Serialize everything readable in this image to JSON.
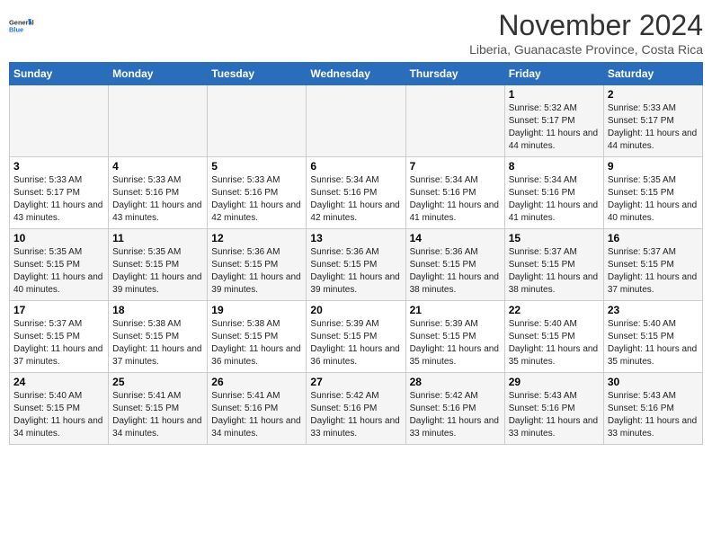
{
  "header": {
    "logo_line1": "General",
    "logo_line2": "Blue",
    "month": "November 2024",
    "location": "Liberia, Guanacaste Province, Costa Rica"
  },
  "weekdays": [
    "Sunday",
    "Monday",
    "Tuesday",
    "Wednesday",
    "Thursday",
    "Friday",
    "Saturday"
  ],
  "weeks": [
    [
      {
        "day": "",
        "info": ""
      },
      {
        "day": "",
        "info": ""
      },
      {
        "day": "",
        "info": ""
      },
      {
        "day": "",
        "info": ""
      },
      {
        "day": "",
        "info": ""
      },
      {
        "day": "1",
        "info": "Sunrise: 5:32 AM\nSunset: 5:17 PM\nDaylight: 11 hours and 44 minutes."
      },
      {
        "day": "2",
        "info": "Sunrise: 5:33 AM\nSunset: 5:17 PM\nDaylight: 11 hours and 44 minutes."
      }
    ],
    [
      {
        "day": "3",
        "info": "Sunrise: 5:33 AM\nSunset: 5:17 PM\nDaylight: 11 hours and 43 minutes."
      },
      {
        "day": "4",
        "info": "Sunrise: 5:33 AM\nSunset: 5:16 PM\nDaylight: 11 hours and 43 minutes."
      },
      {
        "day": "5",
        "info": "Sunrise: 5:33 AM\nSunset: 5:16 PM\nDaylight: 11 hours and 42 minutes."
      },
      {
        "day": "6",
        "info": "Sunrise: 5:34 AM\nSunset: 5:16 PM\nDaylight: 11 hours and 42 minutes."
      },
      {
        "day": "7",
        "info": "Sunrise: 5:34 AM\nSunset: 5:16 PM\nDaylight: 11 hours and 41 minutes."
      },
      {
        "day": "8",
        "info": "Sunrise: 5:34 AM\nSunset: 5:16 PM\nDaylight: 11 hours and 41 minutes."
      },
      {
        "day": "9",
        "info": "Sunrise: 5:35 AM\nSunset: 5:15 PM\nDaylight: 11 hours and 40 minutes."
      }
    ],
    [
      {
        "day": "10",
        "info": "Sunrise: 5:35 AM\nSunset: 5:15 PM\nDaylight: 11 hours and 40 minutes."
      },
      {
        "day": "11",
        "info": "Sunrise: 5:35 AM\nSunset: 5:15 PM\nDaylight: 11 hours and 39 minutes."
      },
      {
        "day": "12",
        "info": "Sunrise: 5:36 AM\nSunset: 5:15 PM\nDaylight: 11 hours and 39 minutes."
      },
      {
        "day": "13",
        "info": "Sunrise: 5:36 AM\nSunset: 5:15 PM\nDaylight: 11 hours and 39 minutes."
      },
      {
        "day": "14",
        "info": "Sunrise: 5:36 AM\nSunset: 5:15 PM\nDaylight: 11 hours and 38 minutes."
      },
      {
        "day": "15",
        "info": "Sunrise: 5:37 AM\nSunset: 5:15 PM\nDaylight: 11 hours and 38 minutes."
      },
      {
        "day": "16",
        "info": "Sunrise: 5:37 AM\nSunset: 5:15 PM\nDaylight: 11 hours and 37 minutes."
      }
    ],
    [
      {
        "day": "17",
        "info": "Sunrise: 5:37 AM\nSunset: 5:15 PM\nDaylight: 11 hours and 37 minutes."
      },
      {
        "day": "18",
        "info": "Sunrise: 5:38 AM\nSunset: 5:15 PM\nDaylight: 11 hours and 37 minutes."
      },
      {
        "day": "19",
        "info": "Sunrise: 5:38 AM\nSunset: 5:15 PM\nDaylight: 11 hours and 36 minutes."
      },
      {
        "day": "20",
        "info": "Sunrise: 5:39 AM\nSunset: 5:15 PM\nDaylight: 11 hours and 36 minutes."
      },
      {
        "day": "21",
        "info": "Sunrise: 5:39 AM\nSunset: 5:15 PM\nDaylight: 11 hours and 35 minutes."
      },
      {
        "day": "22",
        "info": "Sunrise: 5:40 AM\nSunset: 5:15 PM\nDaylight: 11 hours and 35 minutes."
      },
      {
        "day": "23",
        "info": "Sunrise: 5:40 AM\nSunset: 5:15 PM\nDaylight: 11 hours and 35 minutes."
      }
    ],
    [
      {
        "day": "24",
        "info": "Sunrise: 5:40 AM\nSunset: 5:15 PM\nDaylight: 11 hours and 34 minutes."
      },
      {
        "day": "25",
        "info": "Sunrise: 5:41 AM\nSunset: 5:15 PM\nDaylight: 11 hours and 34 minutes."
      },
      {
        "day": "26",
        "info": "Sunrise: 5:41 AM\nSunset: 5:16 PM\nDaylight: 11 hours and 34 minutes."
      },
      {
        "day": "27",
        "info": "Sunrise: 5:42 AM\nSunset: 5:16 PM\nDaylight: 11 hours and 33 minutes."
      },
      {
        "day": "28",
        "info": "Sunrise: 5:42 AM\nSunset: 5:16 PM\nDaylight: 11 hours and 33 minutes."
      },
      {
        "day": "29",
        "info": "Sunrise: 5:43 AM\nSunset: 5:16 PM\nDaylight: 11 hours and 33 minutes."
      },
      {
        "day": "30",
        "info": "Sunrise: 5:43 AM\nSunset: 5:16 PM\nDaylight: 11 hours and 33 minutes."
      }
    ]
  ]
}
